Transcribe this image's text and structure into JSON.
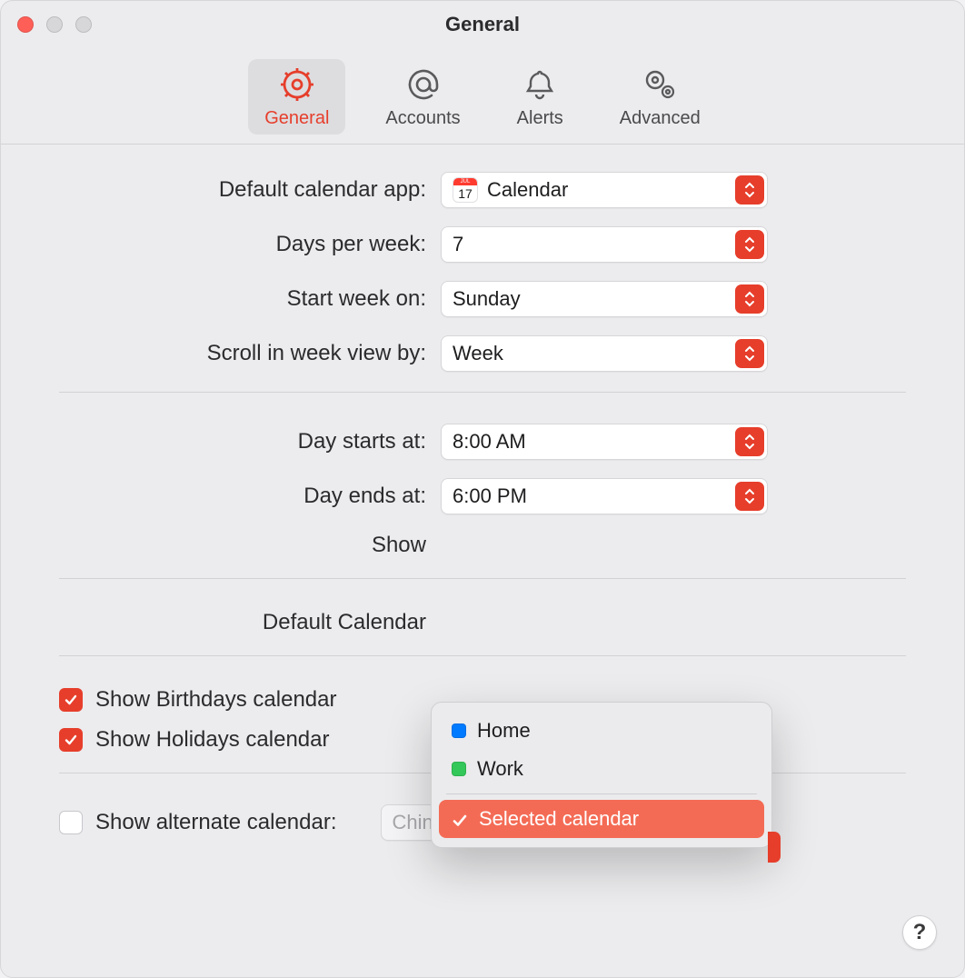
{
  "title": "General",
  "tabs": {
    "general": {
      "label": "General"
    },
    "accounts": {
      "label": "Accounts"
    },
    "alerts": {
      "label": "Alerts"
    },
    "advanced": {
      "label": "Advanced"
    }
  },
  "labels": {
    "default_app": "Default calendar app:",
    "days_per_week": "Days per week:",
    "start_week_on": "Start week on:",
    "scroll_week": "Scroll in week view by:",
    "day_starts": "Day starts at:",
    "day_ends": "Day ends at:",
    "show": "Show",
    "default_calendar": "Default Calendar"
  },
  "values": {
    "default_app": "Calendar",
    "days_per_week": "7",
    "start_week_on": "Sunday",
    "scroll_week": "Week",
    "day_starts": "8:00 AM",
    "day_ends": "6:00 PM",
    "alternate_calendar": "Chinese"
  },
  "cal_icon": {
    "month": "JUL",
    "day": "17"
  },
  "menu": {
    "item1": "Home",
    "item2": "Work",
    "item3": "Selected calendar"
  },
  "checkboxes": {
    "birthdays": "Show Birthdays calendar",
    "holidays": "Show Holidays calendar",
    "alternate": "Show alternate calendar:"
  },
  "help": "?"
}
